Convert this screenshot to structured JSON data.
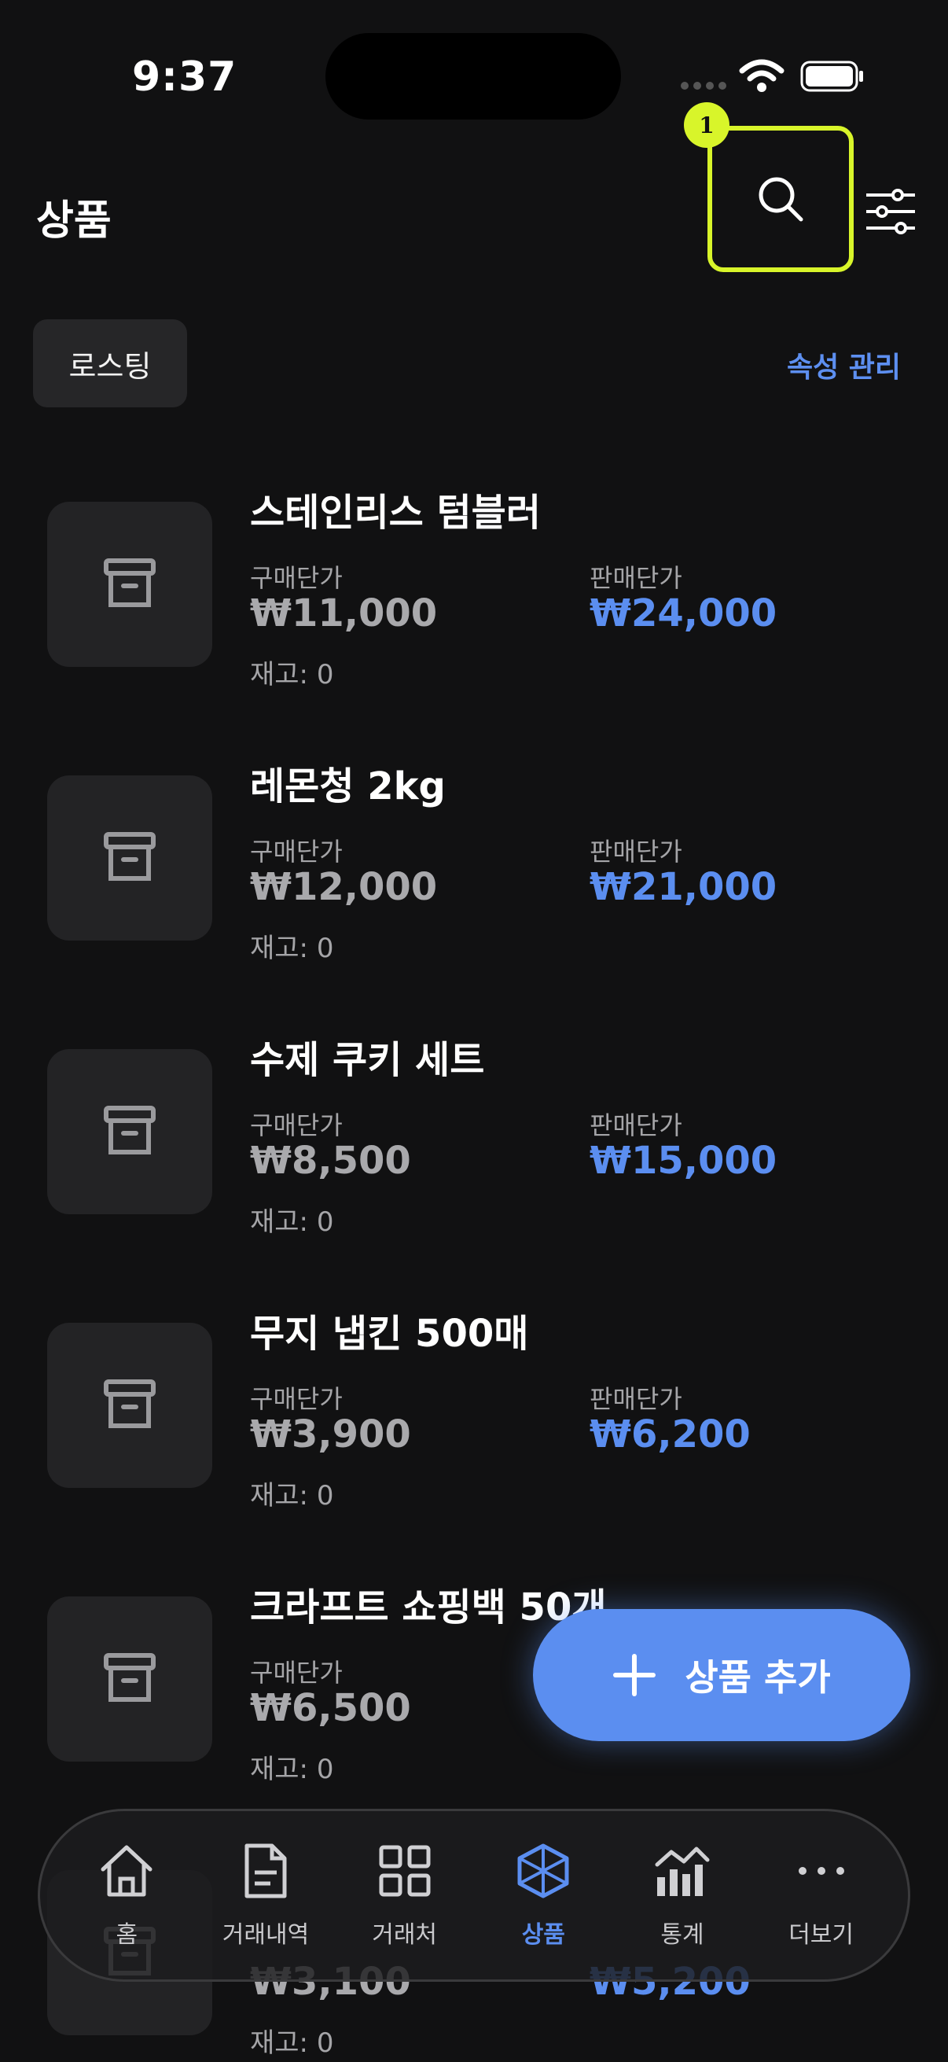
{
  "status_bar": {
    "time": "9:37"
  },
  "header": {
    "title": "상품",
    "badge": "1"
  },
  "filter": {
    "chip_label": "로스팅",
    "attribute_link": "속성 관리"
  },
  "labels": {
    "buy_price": "구매단가",
    "sell_price": "판매단가"
  },
  "products": [
    {
      "name": "스테인리스 텀블러",
      "buy": "₩11,000",
      "sell": "₩24,000",
      "stock": "재고: 0"
    },
    {
      "name": "레몬청 2kg",
      "buy": "₩12,000",
      "sell": "₩21,000",
      "stock": "재고: 0"
    },
    {
      "name": "수제 쿠키 세트",
      "buy": "₩8,500",
      "sell": "₩15,000",
      "stock": "재고: 0"
    },
    {
      "name": "무지 냅킨 500매",
      "buy": "₩3,900",
      "sell": "₩6,200",
      "stock": "재고: 0"
    },
    {
      "name": "크라프트 쇼핑백 50개",
      "buy": "₩6,500",
      "sell": "",
      "stock": "재고: 0"
    },
    {
      "name": "",
      "buy": "₩3,100",
      "sell": "₩5,200",
      "stock": "재고: 0"
    }
  ],
  "fab": {
    "label": "상품 추가"
  },
  "tabbar": {
    "items": [
      {
        "label": "홈",
        "icon": "home-icon"
      },
      {
        "label": "거래내역",
        "icon": "document-icon"
      },
      {
        "label": "거래처",
        "icon": "grid-icon"
      },
      {
        "label": "상품",
        "icon": "cube-icon",
        "active": true
      },
      {
        "label": "통계",
        "icon": "chart-icon"
      },
      {
        "label": "더보기",
        "icon": "more-icon"
      }
    ]
  },
  "colors": {
    "accent": "#5b8ef0",
    "highlight": "#d8f52a",
    "background": "#111112"
  }
}
